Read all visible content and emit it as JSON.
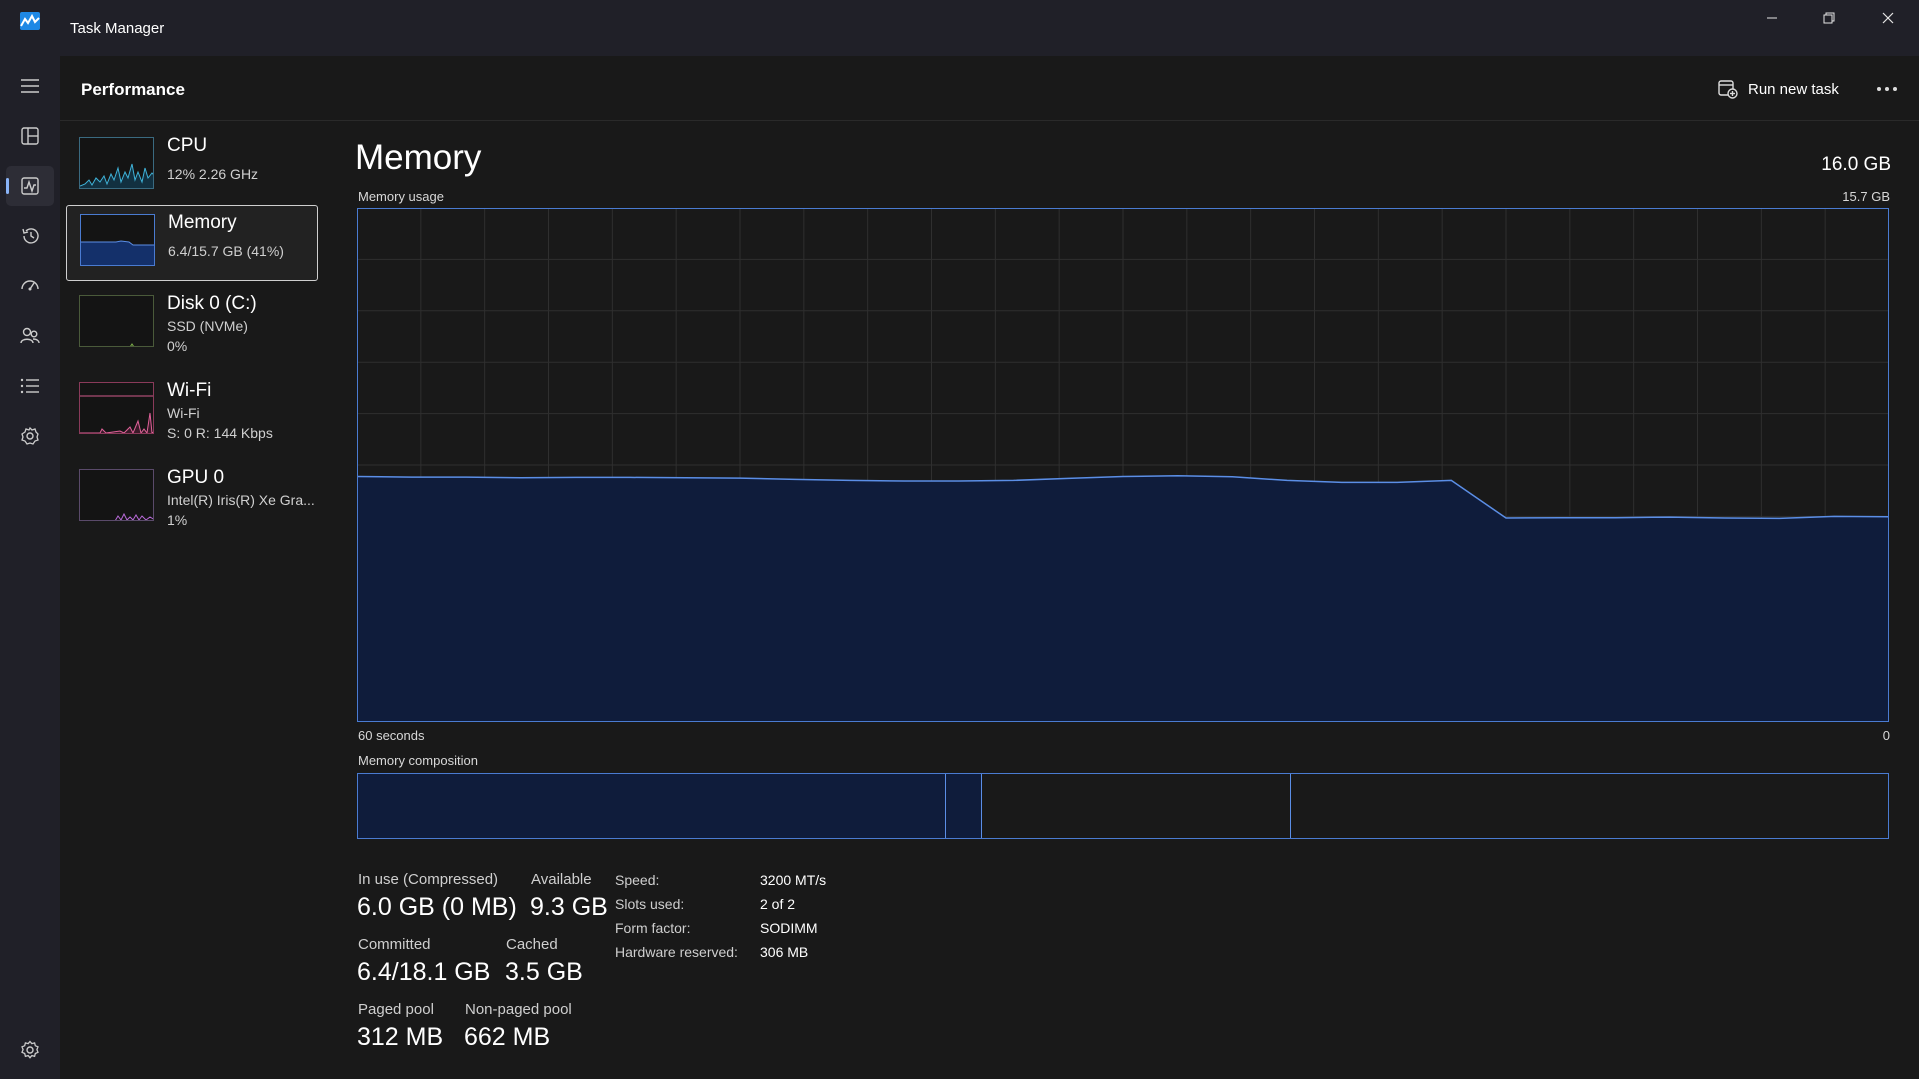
{
  "window": {
    "title": "Task Manager"
  },
  "header": {
    "page_title": "Performance",
    "run_new_task": "Run new task"
  },
  "nav": [
    "menu-icon",
    "processes-icon",
    "performance-icon",
    "app-history-icon",
    "startup-apps-icon",
    "users-icon",
    "details-icon",
    "services-icon",
    "settings-icon"
  ],
  "devices": [
    {
      "name": "CPU",
      "line1": "12%  2.26 GHz",
      "line2": ""
    },
    {
      "name": "Memory",
      "line1": "6.4/15.7 GB (41%)",
      "line2": ""
    },
    {
      "name": "Disk 0 (C:)",
      "line1": "SSD (NVMe)",
      "line2": "0%"
    },
    {
      "name": "Wi-Fi",
      "line1": "Wi-Fi",
      "line2": "S: 0  R: 144 Kbps"
    },
    {
      "name": "GPU 0",
      "line1": "Intel(R) Iris(R) Xe Gra...",
      "line2": "1%"
    }
  ],
  "main": {
    "title": "Memory",
    "total": "16.0 GB",
    "usage_label": "Memory usage",
    "usage_max": "15.7 GB",
    "time_left": "60 seconds",
    "time_right": "0",
    "composition_label": "Memory composition"
  },
  "composition": {
    "in_use_fraction": 0.384,
    "modified_fraction": 0.024,
    "standby_fraction": 0.202,
    "free_fraction": 0.39
  },
  "usage_history_gb": [
    7.5,
    7.48,
    7.48,
    7.46,
    7.47,
    7.47,
    7.46,
    7.45,
    7.41,
    7.38,
    7.36,
    7.36,
    7.38,
    7.44,
    7.5,
    7.52,
    7.49,
    7.38,
    7.32,
    7.32,
    7.38,
    6.23,
    6.24,
    6.24,
    6.26,
    6.23,
    6.22,
    6.28,
    6.27
  ],
  "stats": {
    "in_use_label": "In use (Compressed)",
    "in_use_value": "6.0 GB (0 MB)",
    "available_label": "Available",
    "available_value": "9.3 GB",
    "committed_label": "Committed",
    "committed_value": "6.4/18.1 GB",
    "cached_label": "Cached",
    "cached_value": "3.5 GB",
    "paged_label": "Paged pool",
    "paged_value": "312 MB",
    "nonpaged_label": "Non-paged pool",
    "nonpaged_value": "662 MB"
  },
  "specs": [
    {
      "label": "Speed:",
      "value": "3200 MT/s"
    },
    {
      "label": "Slots used:",
      "value": "2 of 2"
    },
    {
      "label": "Form factor:",
      "value": "SODIMM"
    },
    {
      "label": "Hardware reserved:",
      "value": "306 MB"
    }
  ],
  "colors": {
    "accent": "#8ab4f8",
    "memory_line": "#5b8ee6",
    "memory_fill": "#0f1c3b",
    "grid": "#2f2f2f"
  }
}
